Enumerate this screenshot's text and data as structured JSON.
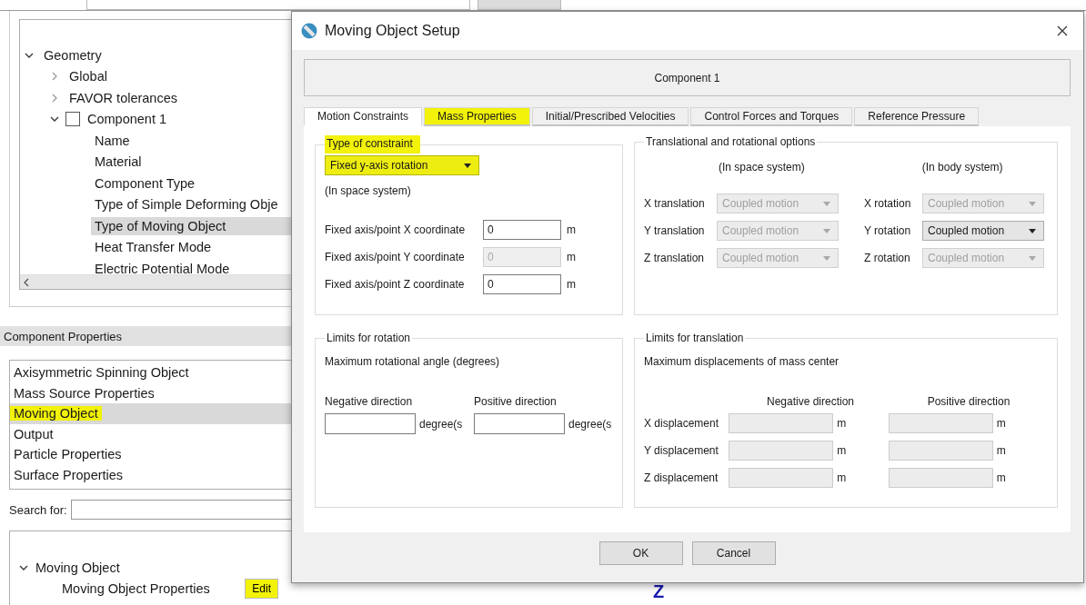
{
  "geometry_tree": [
    {
      "label": "Geometry",
      "expanded": true,
      "children": [
        {
          "label": "Global",
          "expanded": false
        },
        {
          "label": "FAVOR tolerances",
          "expanded": false
        },
        {
          "label": "Component 1",
          "expanded": true,
          "checked": false,
          "children": [
            {
              "label": "Name",
              "selected": false
            },
            {
              "label": "Material",
              "selected": false
            },
            {
              "label": "Component Type",
              "selected": false
            },
            {
              "label": "Type of Simple Deforming Obje",
              "selected": false
            },
            {
              "label": "Type of Moving Object",
              "selected": true
            },
            {
              "label": "Heat Transfer Mode",
              "selected": false
            },
            {
              "label": "Electric Potential Mode",
              "selected": false
            }
          ]
        }
      ]
    }
  ],
  "component_properties": {
    "title": "Component Properties",
    "items": [
      {
        "label": "Axisymmetric Spinning Object",
        "selected": false,
        "highlighted": false
      },
      {
        "label": "Mass Source Properties",
        "selected": false,
        "highlighted": false
      },
      {
        "label": "Moving Object",
        "selected": true,
        "highlighted": true
      },
      {
        "label": "Output",
        "selected": false,
        "highlighted": false
      },
      {
        "label": "Particle Properties",
        "selected": false,
        "highlighted": false
      },
      {
        "label": "Surface Properties",
        "selected": false,
        "highlighted": false
      }
    ]
  },
  "search": {
    "label": "Search for:"
  },
  "property_tree": [
    {
      "label": "Moving Object",
      "expanded": true,
      "children": [
        {
          "label": "Moving Object Properties",
          "button": {
            "label": "Edit",
            "highlighted": true
          }
        }
      ]
    }
  ],
  "viewport": {
    "axis_label": "Z"
  },
  "dialog": {
    "title": "Moving Object Setup",
    "component": "Component 1",
    "tabs": [
      {
        "label": "Motion Constraints",
        "selected": true,
        "highlighted": false
      },
      {
        "label": "Mass Properties",
        "selected": false,
        "highlighted": true
      },
      {
        "label": "Initial/Prescribed Velocities",
        "selected": false,
        "highlighted": false
      },
      {
        "label": "Control Forces and Torques",
        "selected": false,
        "highlighted": false
      },
      {
        "label": "Reference Pressure",
        "selected": false,
        "highlighted": false
      }
    ],
    "constraint_group": {
      "title": "Type of constraint",
      "highlighted": true,
      "dropdown": {
        "value": "Fixed y-axis rotation",
        "highlighted": true
      },
      "note": "(In space system)",
      "coordinates": [
        {
          "label": "Fixed axis/point X coordinate",
          "value": "0",
          "disabled": false,
          "unit": "m"
        },
        {
          "label": "Fixed axis/point Y coordinate",
          "value": "0",
          "disabled": true,
          "unit": "m"
        },
        {
          "label": "Fixed axis/point Z coordinate",
          "value": "0",
          "disabled": false,
          "unit": "m"
        }
      ]
    },
    "options_group": {
      "title": "Translational and rotational options",
      "space_heading": "(In space system)",
      "body_heading": "(In body system)",
      "rows": [
        {
          "translation_label": "X translation",
          "translation": {
            "value": "Coupled motion",
            "disabled": true
          },
          "rotation_label": "X rotation",
          "rotation": {
            "value": "Coupled motion",
            "disabled": true
          }
        },
        {
          "translation_label": "Y translation",
          "translation": {
            "value": "Coupled motion",
            "disabled": true
          },
          "rotation_label": "Y rotation",
          "rotation": {
            "value": "Coupled motion",
            "disabled": false
          }
        },
        {
          "translation_label": "Z translation",
          "translation": {
            "value": "Coupled motion",
            "disabled": true
          },
          "rotation_label": "Z rotation",
          "rotation": {
            "value": "Coupled motion",
            "disabled": true
          }
        }
      ]
    },
    "rotation_limits": {
      "title": "Limits for rotation",
      "description": "Maximum rotational angle (degrees)",
      "fields": [
        {
          "label": "Negative direction",
          "unit": "degree(s",
          "disabled": false
        },
        {
          "label": "Positive direction",
          "unit": "degree(s",
          "disabled": false
        }
      ]
    },
    "translation_limits": {
      "title": "Limits for translation",
      "description": "Maximum displacements of mass center",
      "negative_heading": "Negative direction",
      "positive_heading": "Positive direction",
      "rows": [
        {
          "label": "X displacement",
          "negative_unit": "m",
          "positive_unit": "m",
          "disabled": true
        },
        {
          "label": "Y displacement",
          "negative_unit": "m",
          "positive_unit": "m",
          "disabled": true
        },
        {
          "label": "Z displacement",
          "negative_unit": "m",
          "positive_unit": "m",
          "disabled": true
        }
      ]
    },
    "buttons": [
      "OK",
      "Cancel"
    ]
  }
}
